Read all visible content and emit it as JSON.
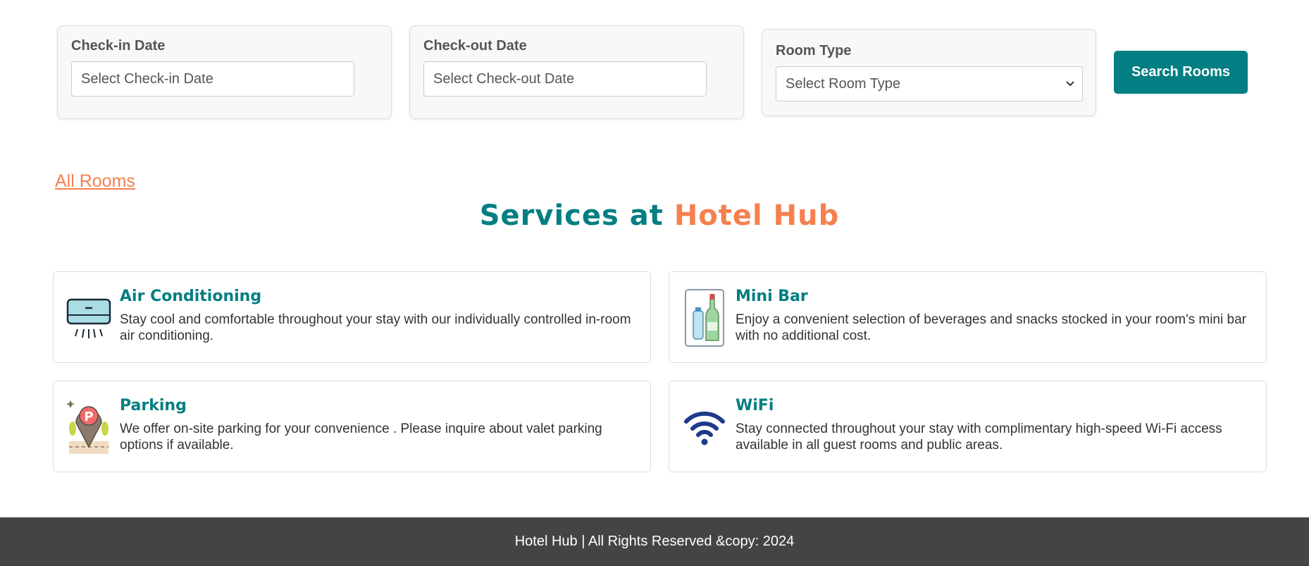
{
  "search": {
    "checkin_label": "Check-in Date",
    "checkin_placeholder": "Select Check-in Date",
    "checkout_label": "Check-out Date",
    "checkout_placeholder": "Select Check-out Date",
    "roomtype_label": "Room Type",
    "roomtype_selected": "Select Room Type",
    "search_button": "Search Rooms"
  },
  "links": {
    "all_rooms": "All Rooms"
  },
  "services": {
    "title_prefix": "Services at",
    "title_brand": "Hotel Hub",
    "items": [
      {
        "name": "Air Conditioning",
        "icon": "air-conditioner-icon",
        "description": "Stay cool and comfortable throughout your stay with our individually controlled in-room air conditioning."
      },
      {
        "name": "Mini Bar",
        "icon": "mini-bar-icon",
        "description": "Enjoy a convenient selection of beverages and snacks stocked in your room's mini bar with no additional cost."
      },
      {
        "name": "Parking",
        "icon": "parking-icon",
        "description": "We offer on-site parking for your convenience . Please inquire about valet parking options if available."
      },
      {
        "name": "WiFi",
        "icon": "wifi-icon",
        "description": "Stay connected throughout your stay with complimentary high-speed Wi-Fi access available in all guest rooms and public areas."
      }
    ]
  },
  "footer": {
    "text": "Hotel Hub | All Rights Reserved &copy: 2024"
  },
  "colors": {
    "accent_teal": "#037e82",
    "accent_orange": "#f5804f",
    "footer_bg": "#444444"
  }
}
